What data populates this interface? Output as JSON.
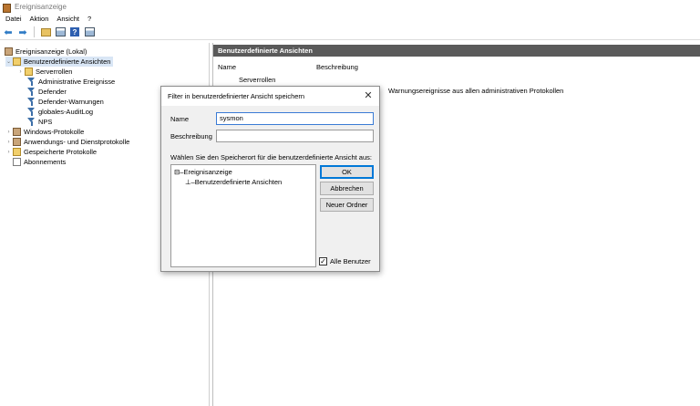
{
  "window": {
    "title": "Ereignisanzeige"
  },
  "menu": {
    "items": [
      "Datei",
      "Aktion",
      "Ansicht",
      "?"
    ]
  },
  "toolbar": {
    "back_icon": "arrow-left-icon",
    "forward_icon": "arrow-right-icon",
    "help_glyph": "?"
  },
  "tree": {
    "items": [
      {
        "label": "Ereignisanzeige (Lokal)",
        "icon": "event-log-icon"
      },
      {
        "label": "Benutzerdefinierte Ansichten",
        "icon": "folder-icon",
        "expander": "⌄"
      },
      {
        "label": "Serverrollen",
        "icon": "folder-icon",
        "expander": "›"
      },
      {
        "label": "Administrative Ereignisse",
        "icon": "filter-icon"
      },
      {
        "label": "Defender",
        "icon": "filter-icon"
      },
      {
        "label": "Defender-Warnungen",
        "icon": "filter-icon"
      },
      {
        "label": "globales-AuditLog",
        "icon": "filter-icon"
      },
      {
        "label": "NPS",
        "icon": "filter-icon"
      },
      {
        "label": "Windows-Protokolle",
        "icon": "event-log-icon",
        "expander": "›"
      },
      {
        "label": "Anwendungs- und Dienstprotokolle",
        "icon": "event-log-icon",
        "expander": "›"
      },
      {
        "label": "Gespeicherte Protokolle",
        "icon": "folder-icon",
        "expander": "›"
      },
      {
        "label": "Abonnements",
        "icon": "subscription-icon"
      }
    ]
  },
  "rightpane": {
    "header": "Benutzerdefinierte Ansichten",
    "columns": [
      "Name",
      "Beschreibung"
    ],
    "rows": [
      {
        "name": "Serverrollen"
      }
    ],
    "partial_description": "Warnungsereignisse aus allen administrativen Protokollen"
  },
  "dialog": {
    "title": "Filter in benutzerdefinierter Ansicht speichern",
    "name_label": "Name",
    "name_value": "sysmon",
    "description_label": "Beschreibung",
    "description_value": "",
    "location_label": "Wählen Sie den Speicherort für die benutzerdefinierte Ansicht aus:",
    "tree_nodes": [
      "Ereignisanzeige",
      "Benutzerdefinierte Ansichten"
    ],
    "ok_label": "OK",
    "cancel_label": "Abbrechen",
    "new_folder_label": "Neuer Ordner",
    "all_users_label": "Alle Benutzer",
    "all_users_checked": true,
    "close_glyph": "✕"
  }
}
